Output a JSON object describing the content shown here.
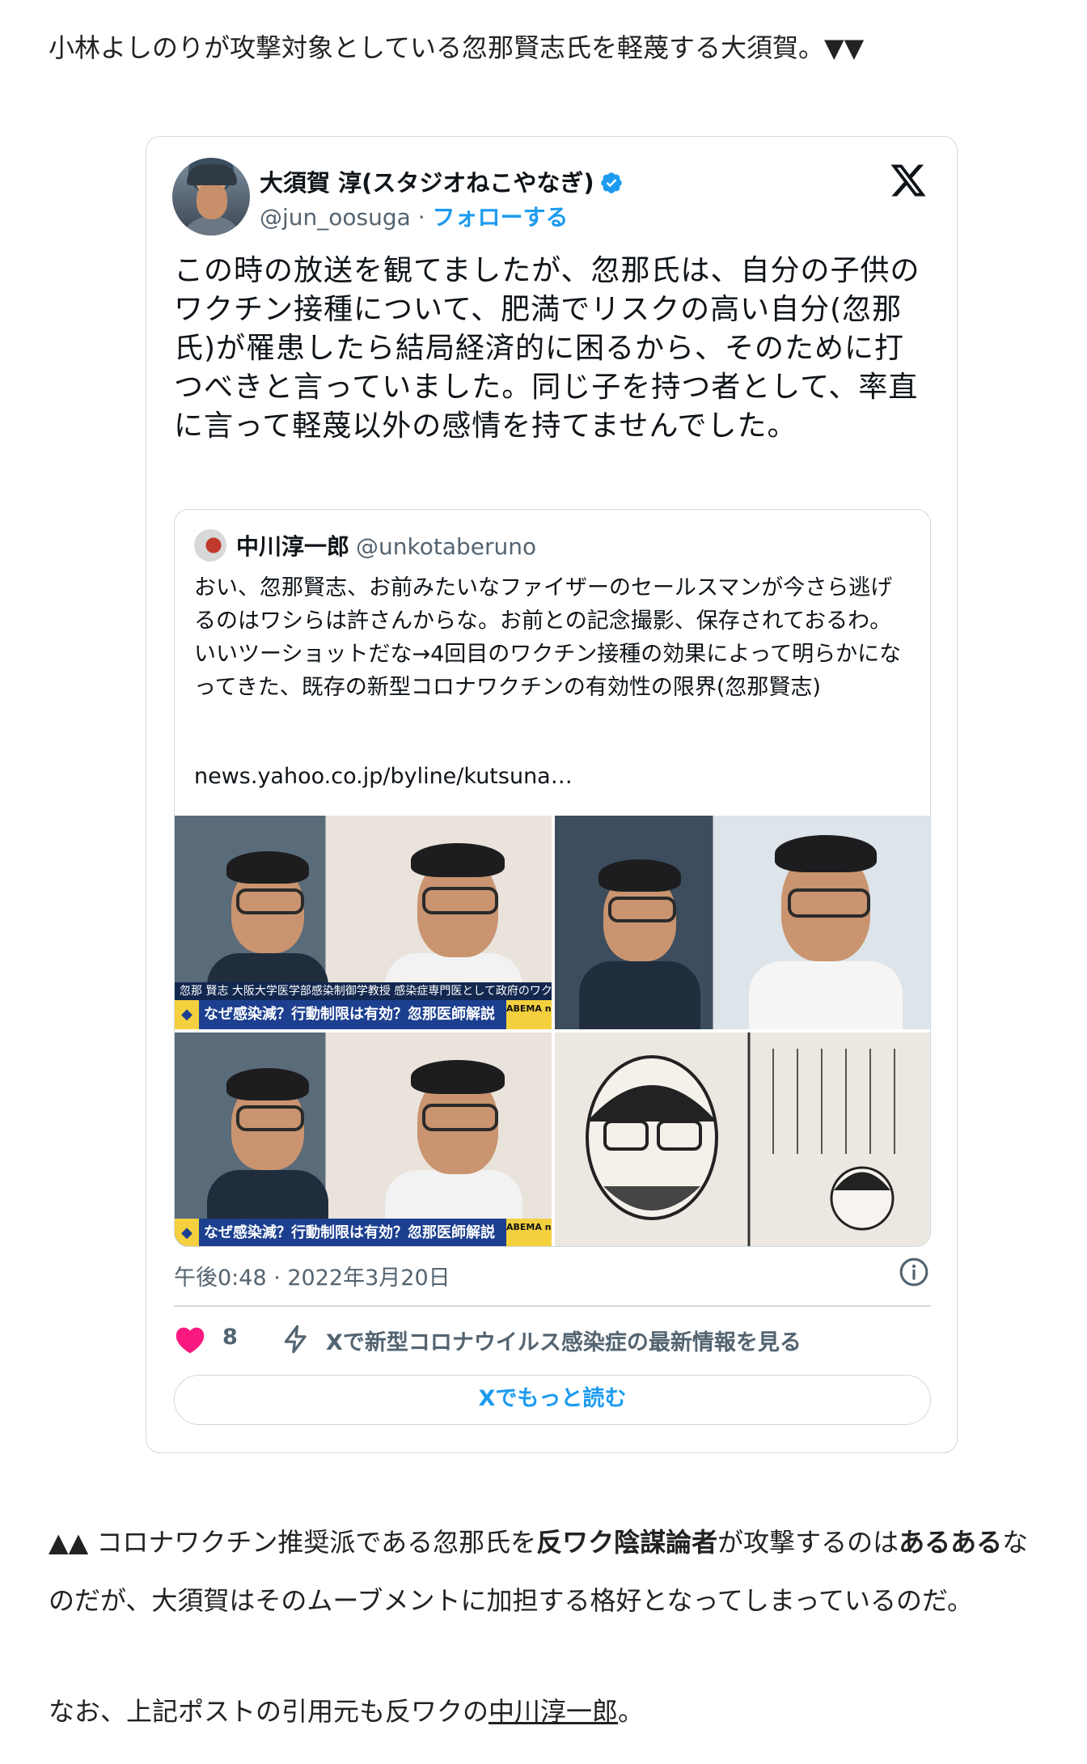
{
  "intro_text": "小林よしのりが攻撃対象としている忽那賢志氏を軽蔑する大須賀。▼▼",
  "tweet": {
    "author_name": "大須賀 淳(スタジオねこやなぎ)",
    "handle": "@jun_oosuga",
    "separator": " · ",
    "follow_label": "フォローする",
    "text": "この時の放送を観てましたが、忽那氏は、自分の子供のワクチン接種について、肥満でリスクの高い自分(忽那氏)が罹患したら結局経済的に困るから、そのために打つべきと言っていました。同じ子を持つ者として、率直に言って軽蔑以外の感情を持てませんでした。",
    "timestamp": "午後0:48 · 2022年3月20日",
    "like_count": "8",
    "covid_link": "Xで新型コロナウイルス感染症の最新情報を見る",
    "read_more": "Xでもっと読む"
  },
  "quoted": {
    "name": "中川淳一郎",
    "handle": "@unkotaberuno",
    "text": "おい、忽那賢志、お前みたいなファイザーのセールスマンが今さら逃げるのはワシらは許さんからな。お前との記念撮影、保存されておるわ。いいツーショットだな→4回目のワクチン接種の効果によって明らかになってきた、既存の新型コロナワクチンの有効性の限界(忽那賢志)",
    "link": "news.yahoo.co.jp/byline/kutsuna…",
    "caption_text": "なぜ感染減？行動制限は有効？忽那医師解説",
    "name_band": "忽那 賢志  大阪大学医学部感染制御学教授  感染症専門医として政府のワクチンCMにも出演",
    "abema_label": "ABEMA news/"
  },
  "after": {
    "part1": "▲▲ コロナワクチン推奨派である忽那氏を",
    "bold1": "反ワク陰謀論者",
    "part2": "が攻撃するのは",
    "bold2": "あるある",
    "part3": "なのだが、大須賀はそのムーブメントに加担する格好となってしまっているのだ。"
  },
  "note": {
    "prefix": "なお、上記ポストの引用元も反ワクの",
    "link_text": "中川淳一郎",
    "suffix": "。"
  },
  "colors": {
    "accent": "#1d9bf0",
    "heart": "#f91880",
    "muted": "#536471",
    "border": "#cfd9de"
  }
}
